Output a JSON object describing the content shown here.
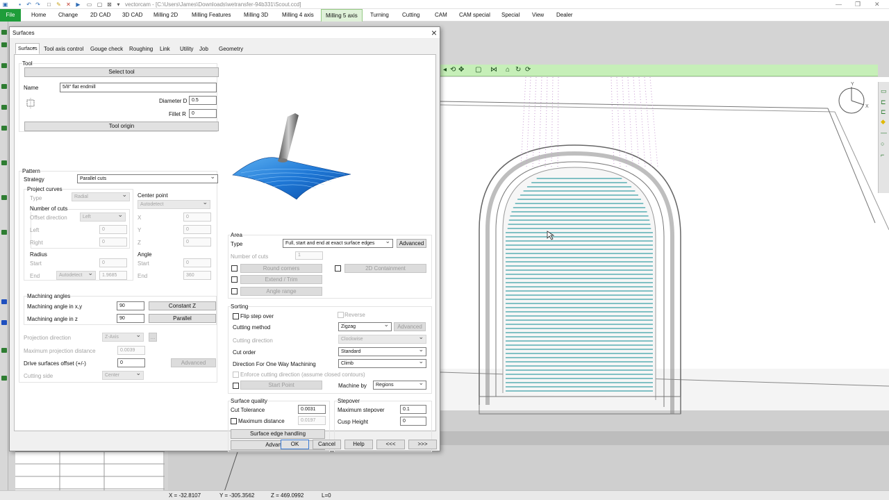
{
  "app": {
    "title": "vectorcam - [C:\\Users\\James\\Downloads\\wetransfer-94b331\\Scout.ccd]",
    "file_tab": "File",
    "menus": [
      "Home",
      "Change",
      "2D CAD",
      "3D CAD",
      "Milling 2D",
      "Milling Features",
      "Milling 3D",
      "Milling 4 axis",
      "Milling 5 axis",
      "Turning",
      "Cutting",
      "CAM",
      "CAM special",
      "Special",
      "View",
      "Dealer"
    ],
    "active_menu": "Milling 5 axis"
  },
  "status": {
    "x": "X = -32.8107",
    "y": "Y = -305.3562",
    "z": "Z = 469.0992",
    "l": "L=0"
  },
  "dialog": {
    "title": "Surfaces",
    "tabs": [
      "Surfaces",
      "Tool axis control",
      "Gouge check",
      "Roughing",
      "Link",
      "Utility",
      "Job",
      "Geometry"
    ],
    "selected_tab": "Surfaces",
    "tool": {
      "section": "Tool",
      "select_button": "Select tool",
      "name_label": "Name",
      "name_value": "5/8\" flat endmill",
      "diameter_label": "Diameter D",
      "diameter_value": "0.5",
      "fillet_label": "Fillet R",
      "fillet_value": "0",
      "origin_button": "Tool origin"
    },
    "pattern": {
      "section": "Pattern",
      "strategy_label": "Strategy",
      "strategy_value": "Parallel cuts",
      "project_curves": "Project curves",
      "type_label": "Type",
      "type_value": "Radial",
      "center_point": "Center point",
      "center_value": "Autodetect",
      "x_label": "X",
      "x_value": "0",
      "y_label": "Y",
      "y_value": "0",
      "z_label": "Z",
      "z_value": "0",
      "num_cuts": "Number of cuts",
      "offset_dir_label": "Offset direction",
      "offset_dir_value": "Left",
      "left_label": "Left",
      "left_value": "0",
      "right_label": "Right",
      "right_value": "0",
      "radius": "Radius",
      "angle": "Angle",
      "r_start_label": "Start",
      "r_start_value": "0",
      "r_end_label": "End",
      "r_end_select": "Autodetect",
      "r_end_value": "1.9685",
      "a_start_label": "Start",
      "a_start_value": "0",
      "a_end_label": "End",
      "a_end_value": "360"
    },
    "machining": {
      "section": "Machining angles",
      "xy_label": "Machining angle in x,y",
      "xy_value": "90",
      "xy_button": "Constant Z",
      "z_label": "Machining angle in z",
      "z_value": "90",
      "z_button": "Parallel"
    },
    "projection": {
      "dir_label": "Projection direction",
      "dir_value": "Z-Axis",
      "dir_btn": "...",
      "maxdist_label": "Maximum projection distance",
      "maxdist_value": "0.0039",
      "drive_label": "Drive surfaces offset (+/-)",
      "drive_value": "0",
      "drive_btn": "Advanced",
      "side_label": "Cutting side",
      "side_value": "Center"
    },
    "area": {
      "section": "Area",
      "type_label": "Type",
      "type_value": "Full, start and end at exact surface edges",
      "advanced": "Advanced",
      "numcuts_label": "Number of cuts",
      "numcuts_value": "1",
      "round_corners": "Round corners",
      "containment": "2D Containment",
      "extend_trim": "Extend / Trim",
      "angle_range": "Angle range"
    },
    "sorting": {
      "section": "Sorting",
      "flip": "Flip step over",
      "reverse": "Reverse",
      "method_label": "Cutting method",
      "method_value": "Zigzag",
      "method_adv": "Advanced",
      "direction_label": "Cutting direction",
      "direction_value": "Clockwise",
      "order_label": "Cut order",
      "order_value": "Standard",
      "oneway_label": "Direction For One Way Machining",
      "oneway_value": "Climb",
      "enforce": "Enforce cutting direction (assume closed contours)",
      "start_point": "Start Point",
      "machine_by_label": "Machine by",
      "machine_by_value": "Regions"
    },
    "quality": {
      "section": "Surface quality",
      "tol_label": "Cut Tolerance",
      "tol_value": "0.0031",
      "maxdist_label": "Maximum distance",
      "maxdist_value": "0.0197",
      "edge_button": "Surface edge handling",
      "adv_button": "Advanced"
    },
    "stepover": {
      "section": "Stepover",
      "max_label": "Maximum stepover",
      "max_value": "0.1",
      "cusp_label": "Cusp Height",
      "cusp_value": "0"
    },
    "footer": {
      "ok": "OK",
      "cancel": "Cancel",
      "help": "Help",
      "prev": "<<<",
      "next": ">>>"
    }
  }
}
